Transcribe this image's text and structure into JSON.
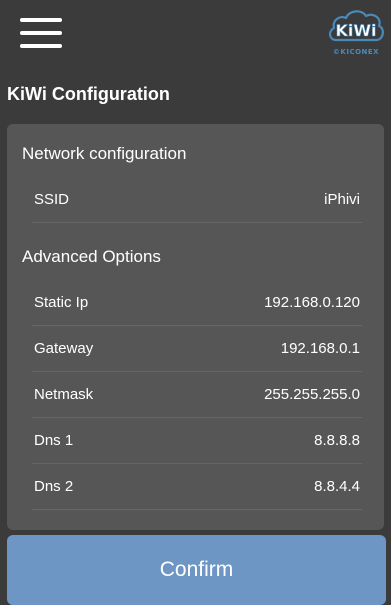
{
  "header": {
    "logo_text": "KiWi",
    "logo_subtitle": "©KICONEX",
    "logo_color": "#4a8ab8"
  },
  "page": {
    "title": "KiWi Configuration"
  },
  "network": {
    "section_title": "Network configuration",
    "ssid_label": "SSID",
    "ssid_value": "iPhivi"
  },
  "advanced": {
    "section_title": "Advanced Options",
    "rows": [
      {
        "label": "Static Ip",
        "value": "192.168.0.120"
      },
      {
        "label": "Gateway",
        "value": "192.168.0.1"
      },
      {
        "label": "Netmask",
        "value": "255.255.255.0"
      },
      {
        "label": "Dns 1",
        "value": "8.8.8.8"
      },
      {
        "label": "Dns 2",
        "value": "8.8.4.4"
      }
    ]
  },
  "actions": {
    "confirm_label": "Confirm",
    "confirm_color": "#6d96c4"
  },
  "colors": {
    "background": "#3b3b3b",
    "card": "#565656"
  }
}
